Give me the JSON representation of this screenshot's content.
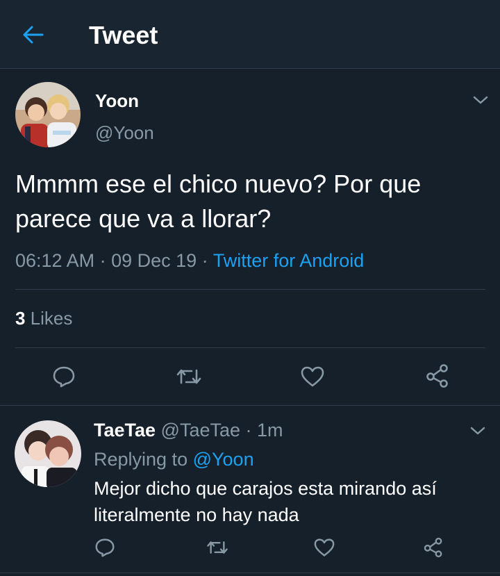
{
  "header": {
    "title": "Tweet"
  },
  "tweet": {
    "author_name": "Yoon",
    "author_handle": "@Yoon",
    "text": "Mmmm ese el chico nuevo? Por que parece que va a llorar?",
    "time": "06:12 AM",
    "sep1": " · ",
    "date": "09 Dec 19",
    "sep2": " · ",
    "source": "Twitter for Android",
    "likes_count": "3",
    "likes_label": " Likes"
  },
  "reply": {
    "author_name": "TaeTae",
    "author_handle": " @TaeTae",
    "time": " · 1m",
    "replying_prefix": "Replying to ",
    "replying_to": "@Yoon",
    "text": "Mejor dicho que carajos esta mirando así literalmente no hay nada"
  },
  "icons": [
    "back-arrow-icon",
    "chevron-down-icon",
    "reply-icon",
    "retweet-icon",
    "like-icon",
    "share-icon"
  ],
  "colors": {
    "background": "#15202b",
    "header": "#1a2532",
    "accent": "#1da1f2",
    "secondary_text": "#8899a6",
    "divider": "#2f3c4b"
  }
}
